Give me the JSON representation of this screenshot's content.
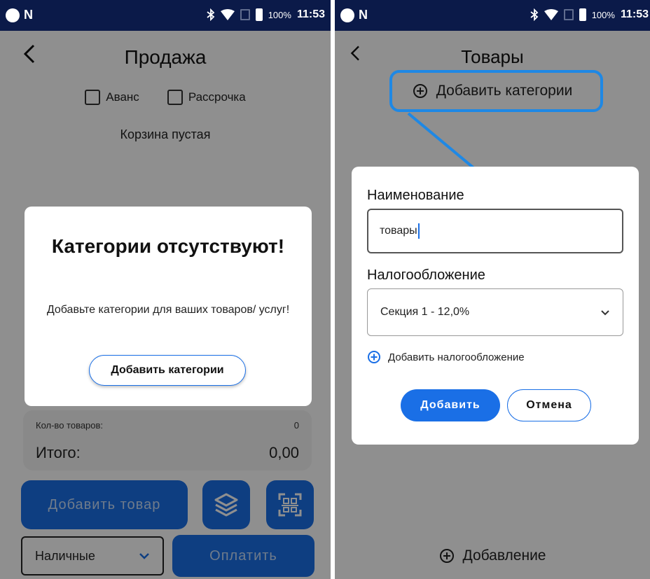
{
  "colors": {
    "status_bar": "#0b1a49",
    "accent": "#1a6fe6",
    "highlight": "#1e88e5",
    "overlay": "rgba(0,0,0,0.44)"
  },
  "status_bar": {
    "network_glyph": "N",
    "battery": "100%",
    "time": "11:53"
  },
  "left": {
    "title": "Продажа",
    "checkbox_advance": "Аванс",
    "checkbox_installment": "Рассрочка",
    "cart_empty": "Корзина пустая",
    "qty_label": "Кол-во товаров:",
    "qty_value": "0",
    "total_label": "Итого:",
    "total_value": "0,00",
    "add_product": "Добавить товар",
    "payment_method": "Наличные",
    "pay": "Оплатить",
    "dialog": {
      "title": "Категории отсутствуют!",
      "text": "Добавьте категории для ваших товаров/ услуг!",
      "button": "Добавить категории"
    }
  },
  "right": {
    "title": "Товары",
    "add_categories": "Добавить категории",
    "bottom_add": "Добавление",
    "dialog": {
      "name_label": "Наименование",
      "name_value": "товары",
      "tax_label": "Налогообложение",
      "tax_value": "Секция 1 - 12,0%",
      "add_tax": "Добавить налогообложение",
      "add_button": "Добавить",
      "cancel_button": "Отмена"
    }
  },
  "icons": [
    "back-icon",
    "bluetooth-icon",
    "wifi-icon",
    "battery-icon",
    "layers-icon",
    "qr-scan-icon",
    "chevron-down-icon",
    "plus-circle-icon",
    "arrow-annotation"
  ]
}
